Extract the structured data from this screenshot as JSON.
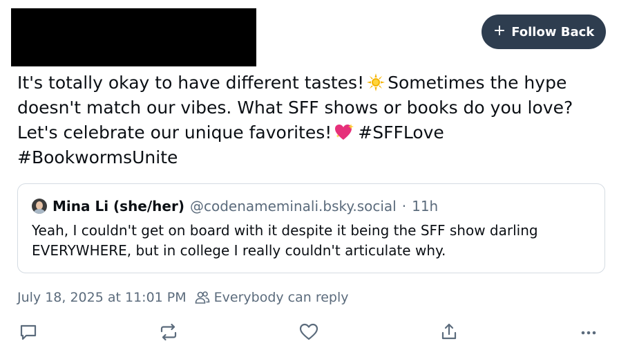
{
  "author": {
    "redacted": true
  },
  "follow_button": {
    "icon": "plus-icon",
    "label": "Follow Back"
  },
  "post": {
    "line1_a": "It's totally okay to have different tastes!",
    "line1_b": "Sometimes the hype",
    "line2": "doesn't match our vibes. What SFF shows or books do you love?",
    "line3_a": "Let's celebrate our unique favorites!",
    "hashtag1": "#SFFLove",
    "hashtag2": "#BookwormsUnite",
    "emoji1": "sun-emoji",
    "emoji2": "sparkling-heart-emoji"
  },
  "quote": {
    "name": "Mina Li (she/her)",
    "handle": "@codenameminali.bsky.social",
    "separator": "·",
    "time": "11h",
    "text": "Yeah, I couldn't get on board with it despite it being the SFF show darling EVERYWHERE, but in college I really couldn't articulate why."
  },
  "meta": {
    "timestamp": "July 18, 2025 at 11:01 PM",
    "reply_setting": "Everybody can reply"
  },
  "actions": [
    "reply-icon",
    "repost-icon",
    "like-icon",
    "share-icon",
    "more-icon"
  ],
  "colors": {
    "button_bg": "#2e3d4f",
    "muted_text": "#5b6b7c",
    "icon": "#5b6b7c",
    "border": "#d4dbe2"
  }
}
